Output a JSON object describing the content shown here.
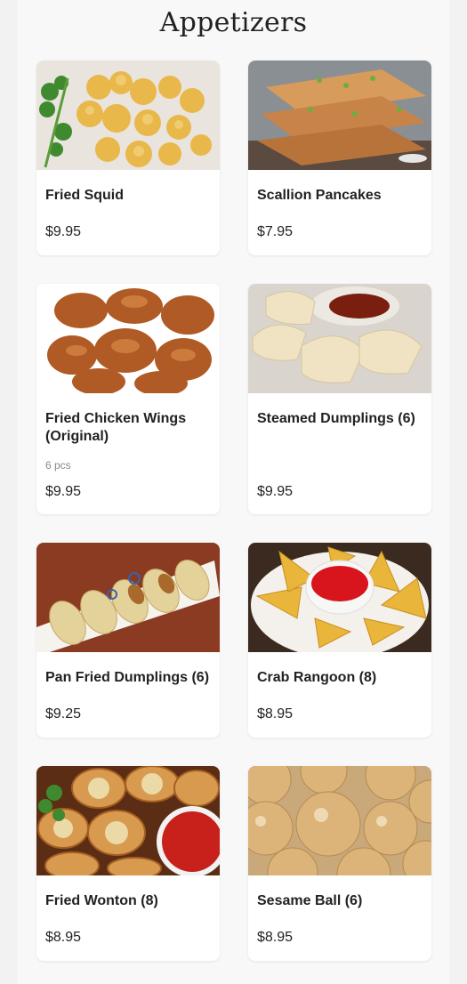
{
  "section": {
    "title": "Appetizers"
  },
  "items": [
    {
      "name": "Fried Squid",
      "price": "$9.95"
    },
    {
      "name": "Scallion Pancakes",
      "price": "$7.95"
    },
    {
      "name": "Fried Chicken Wings (Original)",
      "desc": "6 pcs",
      "price": "$9.95"
    },
    {
      "name": "Steamed Dumplings (6)",
      "price": "$9.95"
    },
    {
      "name": "Pan Fried Dumplings (6)",
      "price": "$9.25"
    },
    {
      "name": "Crab Rangoon (8)",
      "price": "$8.95"
    },
    {
      "name": "Fried Wonton (8)",
      "price": "$8.95"
    },
    {
      "name": "Sesame Ball (6)",
      "price": "$8.95"
    }
  ]
}
